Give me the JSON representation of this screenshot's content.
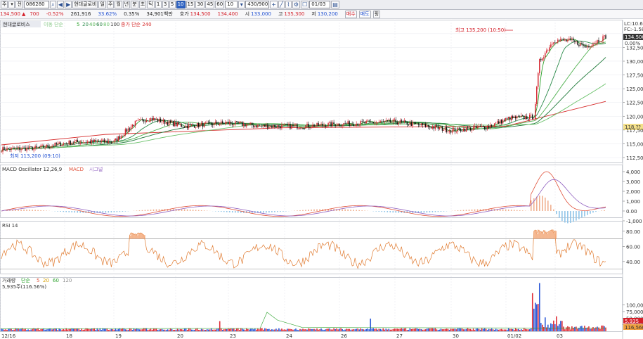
{
  "toolbar": {
    "menu_label": "주",
    "btn_jeon": "전",
    "code": "086280",
    "company_btn": "현대글로비",
    "period_buttons": [
      "일",
      "주",
      "월",
      "년",
      "분",
      "초",
      "틱",
      "1",
      "3",
      "5",
      "10",
      "15",
      "30",
      "45",
      "60"
    ],
    "period_selected": "10",
    "interval_value": "10",
    "count_value": "430/900",
    "date_value": "01/03"
  },
  "quote": {
    "price": "134,500",
    "change": "700",
    "change_pct": "-0.52%",
    "volume": "261,916",
    "rate1": "33.62%",
    "rate2": "0.35%",
    "amount": "34,901백만",
    "ask_label": "호가",
    "ask": "134,500",
    "bid": "134,400",
    "open_label": "시",
    "open": "133,000",
    "high_label": "고",
    "high": "135,300",
    "low_label": "저",
    "low": "130,200",
    "buy_label": "매수",
    "sell_label": "매도",
    "extra_label": "핑"
  },
  "price_panel": {
    "title": "현대글로비스",
    "legend_ma": "이동 단순",
    "ma_periods": [
      "5",
      "20",
      "40",
      "60",
      "80",
      "100"
    ],
    "vol_ma_legend": "종가 단순 240",
    "high_annotation": "최고 135,200 (10:50)",
    "low_annotation": "최저 113,200 (09:10)",
    "axis_top_labels": [
      "LC:10.62",
      "FC:-1.58"
    ],
    "axis_ticks": [
      "135,000",
      "132,500",
      "130,000",
      "127,500",
      "125,000",
      "122,500",
      "120,000",
      "117,500",
      "115,000",
      "112,500"
    ],
    "price_tag": "134,500",
    "pct_tag": "0.00%",
    "left_tag": "118,??"
  },
  "macd_panel": {
    "title": "MACD Oscillator 12,26,9",
    "macd_label": "MACD",
    "signal_label": "시그널",
    "axis_ticks": [
      "4,000",
      "3,000",
      "2,000",
      "1,000",
      "0.00",
      "-1,000"
    ]
  },
  "rsi_panel": {
    "title": "RSI 14",
    "axis_ticks": [
      "80.00",
      "60.00",
      "40.00"
    ]
  },
  "volume_panel": {
    "title": "거래량",
    "ma_legend": "단순",
    "ma_periods": [
      "5",
      "20",
      "60",
      "120"
    ],
    "volume_text": "5,935주(116.56%)",
    "axis_ticks": [
      "100,000",
      "75,000",
      "50,000",
      "25,000"
    ],
    "tag_red": "5,935",
    "tag_orange": "116,560"
  },
  "x_axis": {
    "labels": [
      "12/16",
      "18",
      "19",
      "20",
      "23",
      "24",
      "26",
      "27",
      "30",
      "01/02",
      "03"
    ]
  },
  "colors": {
    "up": "#d4202a",
    "down": "#1f4fd1",
    "ma5": "#2aa12a",
    "ma20": "#2a8a4a",
    "ma40": "#4fb04f",
    "ma60": "#1f7a3a",
    "ma100": "#69c169",
    "ma240": "#d62b2b",
    "macd": "#e0513a",
    "signal": "#8f5fbf",
    "rsi": "#e07a2f"
  }
}
